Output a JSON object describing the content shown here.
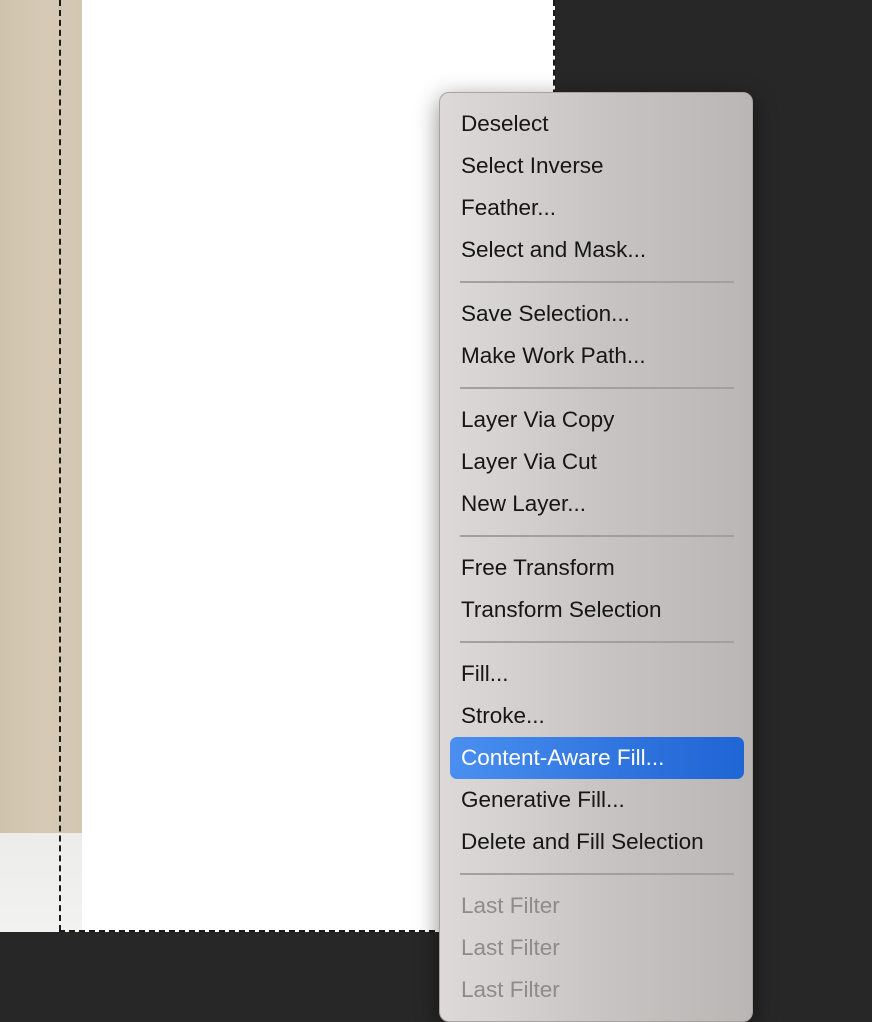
{
  "context_menu": {
    "groups": [
      {
        "items": [
          {
            "label": "Deselect",
            "state": "normal"
          },
          {
            "label": "Select Inverse",
            "state": "normal"
          },
          {
            "label": "Feather...",
            "state": "normal"
          },
          {
            "label": "Select and Mask...",
            "state": "normal"
          }
        ]
      },
      {
        "items": [
          {
            "label": "Save Selection...",
            "state": "normal"
          },
          {
            "label": "Make Work Path...",
            "state": "normal"
          }
        ]
      },
      {
        "items": [
          {
            "label": "Layer Via Copy",
            "state": "normal"
          },
          {
            "label": "Layer Via Cut",
            "state": "normal"
          },
          {
            "label": "New Layer...",
            "state": "normal"
          }
        ]
      },
      {
        "items": [
          {
            "label": "Free Transform",
            "state": "normal"
          },
          {
            "label": "Transform Selection",
            "state": "normal"
          }
        ]
      },
      {
        "items": [
          {
            "label": "Fill...",
            "state": "normal"
          },
          {
            "label": "Stroke...",
            "state": "normal"
          },
          {
            "label": "Content-Aware Fill...",
            "state": "highlighted"
          },
          {
            "label": "Generative Fill...",
            "state": "normal"
          },
          {
            "label": "Delete and Fill Selection",
            "state": "normal"
          }
        ]
      },
      {
        "items": [
          {
            "label": "Last Filter",
            "state": "disabled"
          },
          {
            "label": "Last Filter",
            "state": "disabled"
          },
          {
            "label": "Last Filter",
            "state": "disabled"
          }
        ]
      }
    ]
  },
  "colors": {
    "highlight": "#2f74de",
    "app_background": "#272727",
    "canvas": "#ffffff",
    "disabled_text": "#8e8b8a"
  }
}
